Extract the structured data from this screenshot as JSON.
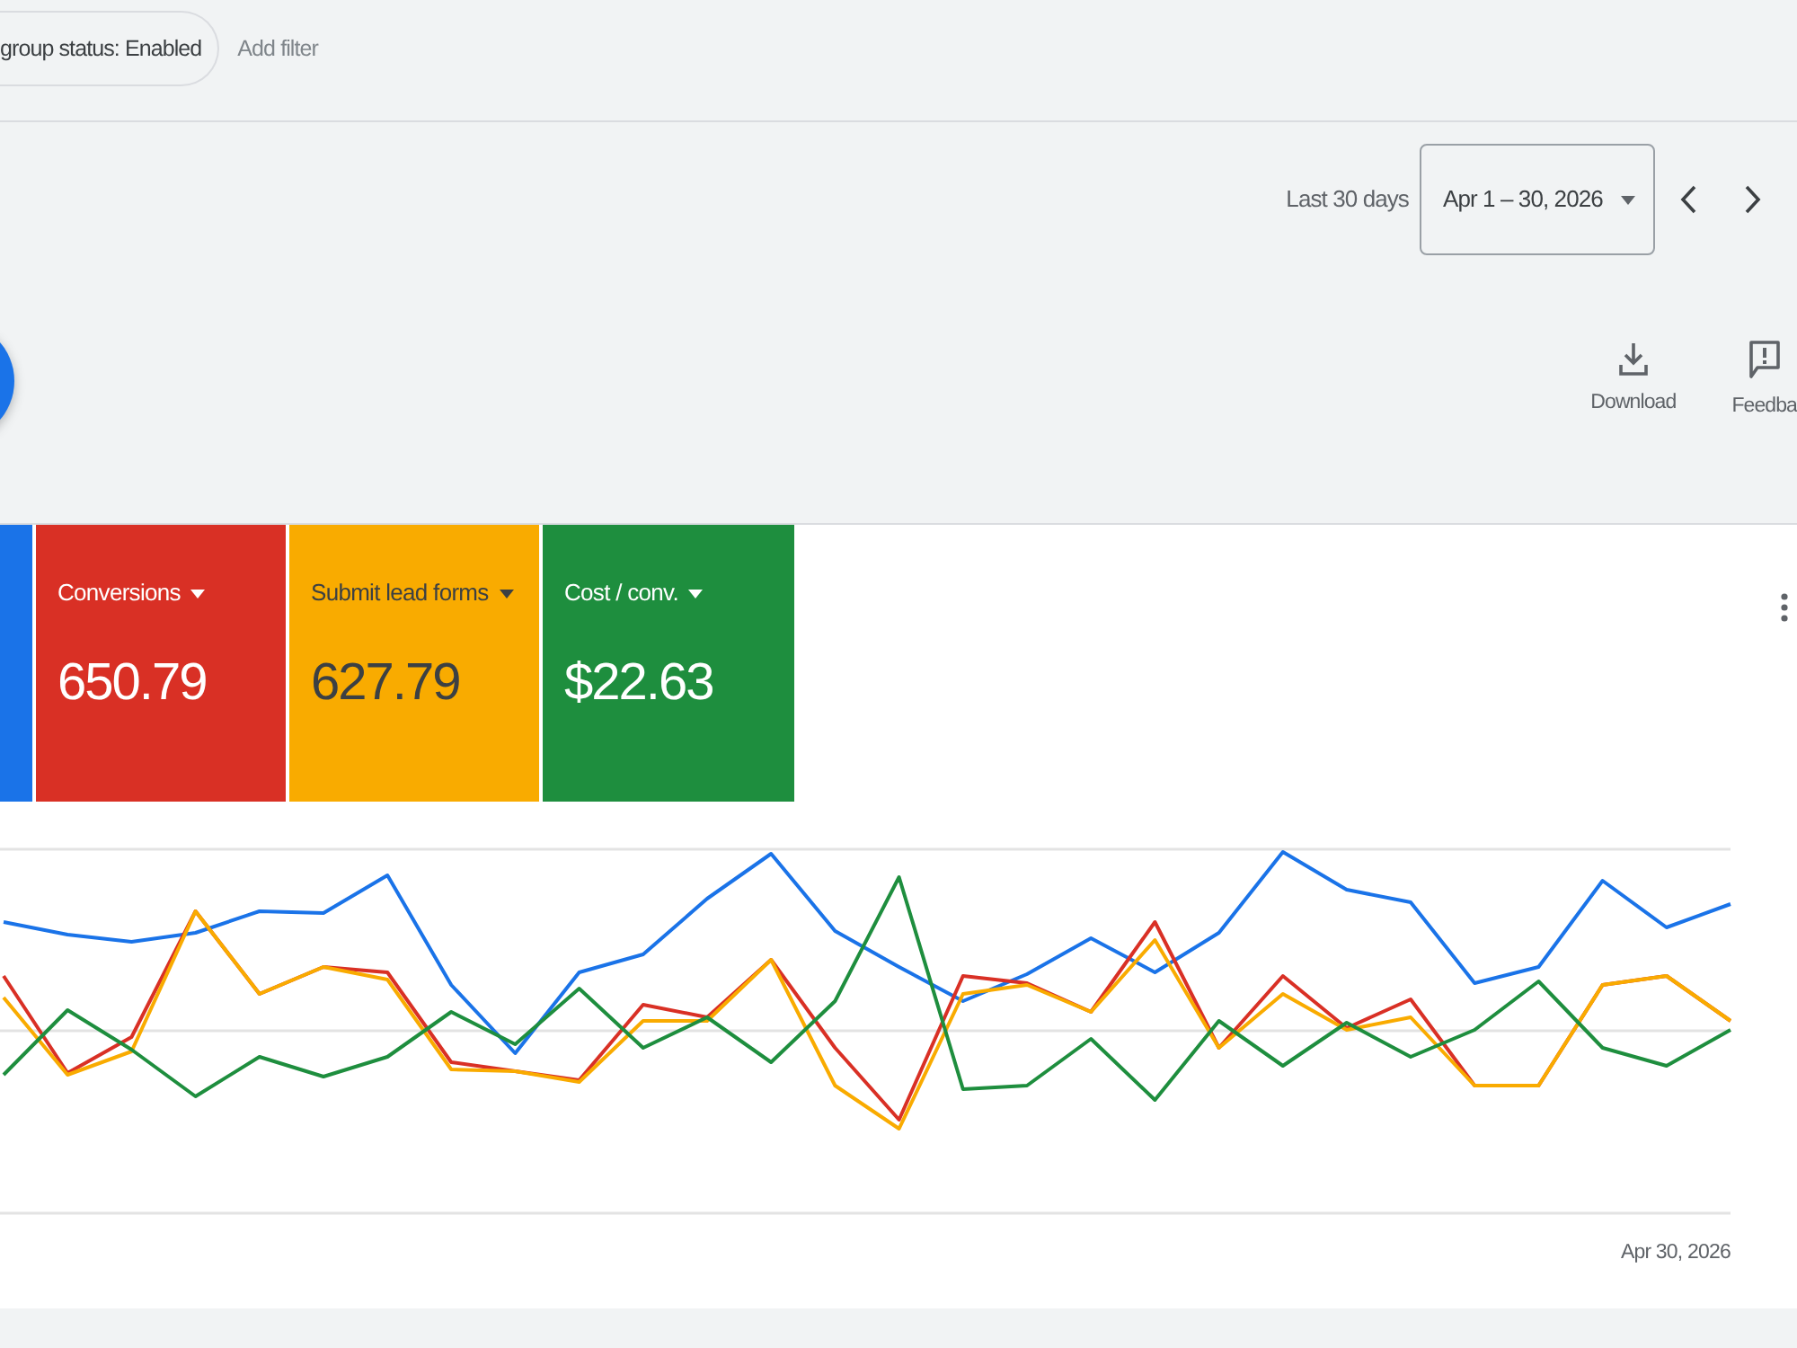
{
  "filter_bar": {
    "chips": [
      {
        "text": "group status: Enabled"
      }
    ],
    "add_filter": "Add filter"
  },
  "date_range": {
    "preset": "Last 30 days",
    "value": "Apr 1 – 30, 2026"
  },
  "actions": [
    {
      "kind": "download",
      "label": "Download"
    },
    {
      "kind": "feedback",
      "label": "Feedba"
    }
  ],
  "metrics": [
    {
      "color": "#1a73e8",
      "selected": true
    },
    {
      "label": "Conversions",
      "value": "650.79",
      "color": "#d93025",
      "selected": true
    },
    {
      "label": "Submit lead forms",
      "value": "627.79",
      "color": "#f9ab00",
      "selected": true
    },
    {
      "label": "Cost / conv.",
      "value": "$22.63",
      "color": "#1e8e3e",
      "selected": true
    }
  ],
  "chart": {
    "x_end_label": "Apr 30, 2026"
  }
}
